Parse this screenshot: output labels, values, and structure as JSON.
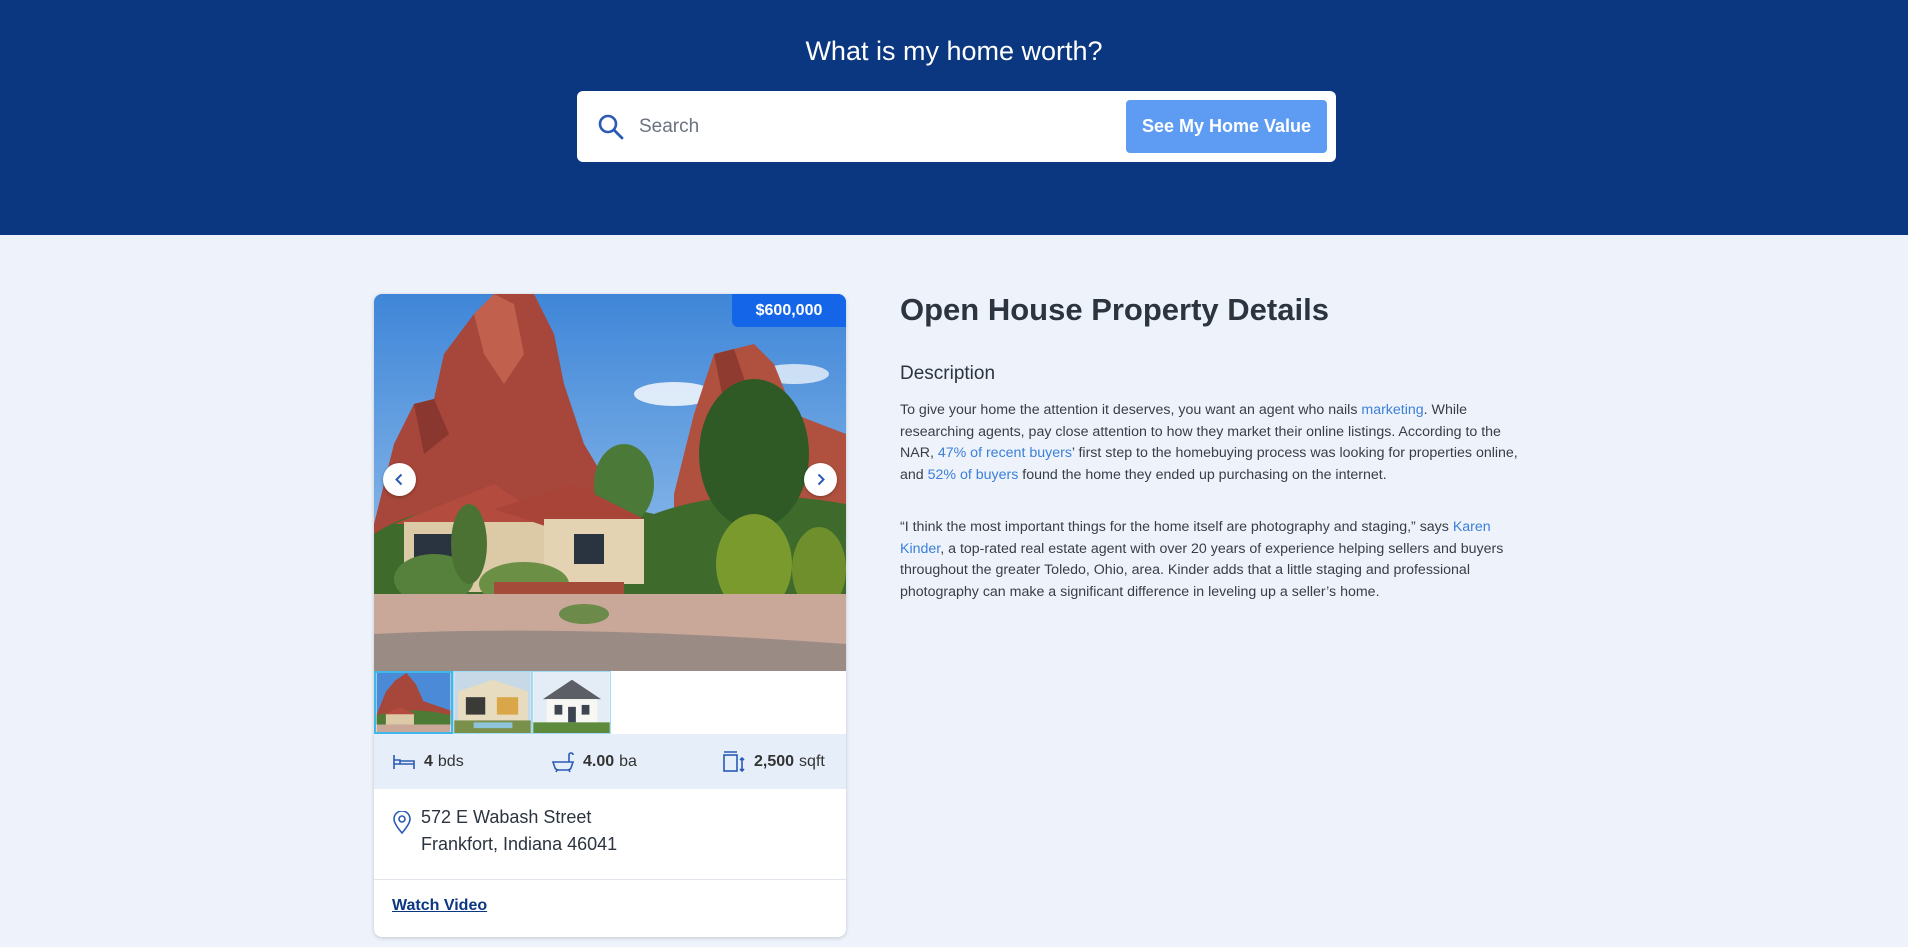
{
  "hero": {
    "title": "What is my home worth?",
    "search_placeholder": "Search",
    "search_button": "See My Home Value",
    "bg_color": "#0a3780"
  },
  "listing": {
    "price": "$600,000",
    "photo_count": 3,
    "beds_value": "4",
    "beds_unit": "bds",
    "baths_value": "4.00",
    "baths_unit": "ba",
    "area_value": "2,500",
    "area_unit": "sqft",
    "address_line1": "572 E Wabash Street",
    "address_line2": "Frankfort, Indiana 46041",
    "watch_video": "Watch Video"
  },
  "details": {
    "title": "Open House Property Details",
    "description_heading": "Description",
    "p1_a": "To give your home the attention it deserves, you want an agent who nails ",
    "p1_link1": "marketing",
    "p1_b": ". While researching agents, pay close attention to how they market their online listings. According to the NAR, ",
    "p1_link2": "47% of recent buyers",
    "p1_c": "’ first step to the homebuying process was looking for properties online, and ",
    "p1_link3": "52% of buyers",
    "p1_d": " found the home they ended up purchasing on the internet.",
    "p2_a": "“I think the most important things for the home itself are photography and staging,” says ",
    "p2_link": "Karen Kinder",
    "p2_b": ", a top-rated real estate agent with over 20 years of experience helping sellers and buyers throughout the greater Toledo, Ohio, area. Kinder adds that a little staging and professional photography can make a significant difference in leveling up a seller’s home."
  }
}
